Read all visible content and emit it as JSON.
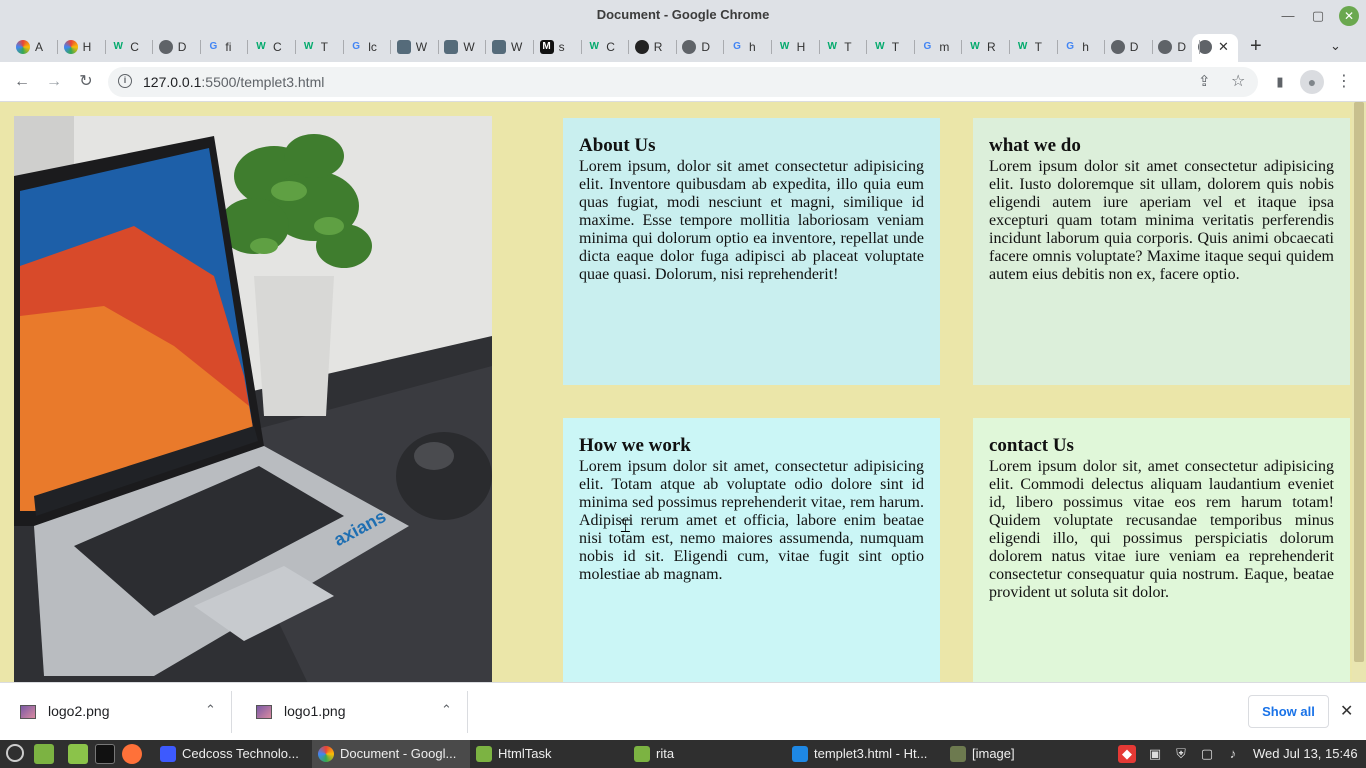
{
  "window": {
    "title": "Document - Google Chrome",
    "min_glyph": "—",
    "max_glyph": "▢",
    "close_glyph": "✕"
  },
  "tabs": [
    {
      "icon": "colorful-icon",
      "letter": "A",
      "glyph": ""
    },
    {
      "icon": "colorful-icon",
      "letter": "H",
      "glyph": ""
    },
    {
      "icon": "w3schools-icon",
      "letter": "C",
      "glyph": "W"
    },
    {
      "icon": "globe-icon",
      "letter": "D",
      "glyph": ""
    },
    {
      "icon": "google-icon",
      "letter": "fi",
      "glyph": "G"
    },
    {
      "icon": "w3schools-icon",
      "letter": "C",
      "glyph": "W"
    },
    {
      "icon": "w3schools-icon",
      "letter": "T",
      "glyph": "W"
    },
    {
      "icon": "google-icon",
      "letter": "lc",
      "glyph": "G"
    },
    {
      "icon": "image-icon",
      "letter": "W",
      "glyph": ""
    },
    {
      "icon": "image-icon",
      "letter": "W",
      "glyph": ""
    },
    {
      "icon": "image-icon",
      "letter": "W",
      "glyph": ""
    },
    {
      "icon": "m-icon",
      "letter": "s",
      "glyph": "M"
    },
    {
      "icon": "w3schools-icon",
      "letter": "C",
      "glyph": "W"
    },
    {
      "icon": "github-icon",
      "letter": "R",
      "glyph": ""
    },
    {
      "icon": "globe-icon",
      "letter": "D",
      "glyph": ""
    },
    {
      "icon": "google-icon",
      "letter": "h",
      "glyph": "G"
    },
    {
      "icon": "w3schools-icon",
      "letter": "H",
      "glyph": "W"
    },
    {
      "icon": "w3schools-icon",
      "letter": "T",
      "glyph": "W"
    },
    {
      "icon": "w3schools-icon",
      "letter": "T",
      "glyph": "W"
    },
    {
      "icon": "google-icon",
      "letter": "m",
      "glyph": "G"
    },
    {
      "icon": "w3schools-icon",
      "letter": "R",
      "glyph": "W"
    },
    {
      "icon": "w3schools-icon",
      "letter": "T",
      "glyph": "W"
    },
    {
      "icon": "google-icon",
      "letter": "h",
      "glyph": "G"
    },
    {
      "icon": "globe-icon",
      "letter": "D",
      "glyph": ""
    },
    {
      "icon": "globe-icon",
      "letter": "D",
      "glyph": ""
    }
  ],
  "active_tab": {
    "icon": "globe-icon",
    "close_glyph": "✕"
  },
  "new_tab_glyph": "+",
  "tab_menu_glyph": "⌄",
  "toolbar": {
    "back_glyph": "←",
    "forward_glyph": "→",
    "reload_glyph": "↻",
    "url_host": "127.0.0.1",
    "url_path": ":5500/templet3.html",
    "share_glyph": "⇪",
    "star_glyph": "☆",
    "sidepanel_glyph": "▮",
    "profile_glyph": "●",
    "menu_glyph": "⋮"
  },
  "page": {
    "cards": [
      {
        "title": "About Us",
        "body": "Lorem ipsum, dolor sit amet consectetur adipisicing elit. Inventore quibusdam ab expedita, illo quia eum quas fugiat, modi nesciunt et magni, similique id maxime. Esse tempore mollitia laboriosam veniam minima qui dolorum optio ea inventore, repellat unde dicta eaque dolor fuga adipisci ab placeat voluptate quae quasi. Dolorum, nisi reprehenderit!"
      },
      {
        "title": "what we do",
        "body": "Lorem ipsum dolor sit amet consectetur adipisicing elit. Iusto doloremque sit ullam, dolorem quis nobis eligendi autem iure aperiam vel et itaque ipsa excepturi quam totam minima veritatis perferendis incidunt laborum quia corporis. Quis animi obcaecati facere omnis voluptate? Maxime itaque sequi quidem autem eius debitis non ex, facere optio."
      },
      {
        "title": "How we work",
        "body": "Lorem ipsum dolor sit amet, consectetur adipisicing elit. Totam atque ab voluptate odio dolore sint id minima sed possimus reprehenderit vitae, rem harum. Adipisci rerum amet et officia, labore enim beatae nisi totam est, nemo maiores assumenda, numquam nobis id sit. Eligendi cum, vitae fugit sint optio molestiae ab magnam."
      },
      {
        "title": "contact Us",
        "body": "Lorem ipsum dolor sit, amet consectetur adipisicing elit. Commodi delectus aliquam laudantium eveniet id, libero possimus vitae eos rem harum totam! Quidem voluptate recusandae temporibus minus eligendi illo, qui possimus perspiciatis dolorum dolorem natus vitae iure veniam ea reprehenderit consectetur consequatur quia nostrum. Eaque, beatae provident ut soluta sit dolor."
      }
    ],
    "hero_laptop_brand": "axians"
  },
  "downloads": {
    "items": [
      {
        "name": "logo2.png",
        "chevron": "⌃"
      },
      {
        "name": "logo1.png",
        "chevron": "⌃"
      }
    ],
    "show_all": "Show all",
    "close_glyph": "✕"
  },
  "taskbar": {
    "items": [
      {
        "label": "Cedcoss Technolo...",
        "icon": "chat-icon"
      },
      {
        "label": "Document - Googl...",
        "icon": "chrome-icon"
      },
      {
        "label": "HtmlTask",
        "icon": "folder-icon"
      },
      {
        "label": "rita",
        "icon": "folder-icon"
      },
      {
        "label": "templet3.html - Ht...",
        "icon": "vscode-icon"
      },
      {
        "label": "[image]",
        "icon": "folder-icon"
      }
    ],
    "clock": "Wed Jul 13, 15:46"
  },
  "colors": {
    "page_bg": "#ebe6a9",
    "card1": "#c9efef",
    "card2": "#dcefda",
    "card3": "#cbf6f6",
    "card4": "#e0f7d9",
    "link_blue": "#1a73e8"
  }
}
